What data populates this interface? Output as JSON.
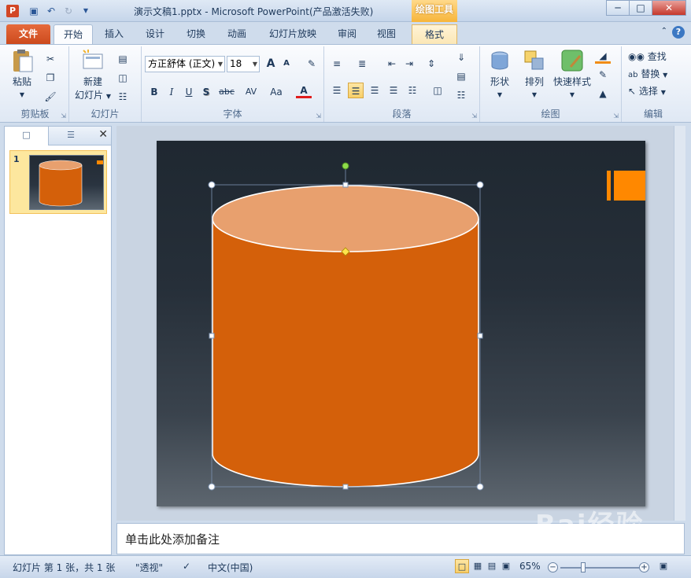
{
  "window": {
    "title": "演示文稿1.pptx - Microsoft PowerPoint(产品激活失败)",
    "app_icon_letter": "P",
    "contextual_tab_title": "绘图工具",
    "minimize": "─",
    "maximize": "□",
    "close": "✕"
  },
  "tabs": {
    "file": "文件",
    "home": "开始",
    "insert": "插入",
    "design": "设计",
    "transitions": "切换",
    "animations": "动画",
    "slideshow": "幻灯片放映",
    "review": "审阅",
    "view": "视图",
    "format": "格式"
  },
  "ribbon": {
    "clipboard": {
      "label": "剪贴板",
      "paste": "粘贴"
    },
    "slides": {
      "label": "幻灯片",
      "new_slide_line1": "新建",
      "new_slide_line2": "幻灯片"
    },
    "font": {
      "label": "字体",
      "font_name": "方正舒体 (正文)",
      "font_size": "18",
      "bold": "B",
      "italic": "I",
      "underline": "U",
      "shadow": "S",
      "strike": "abc",
      "spacing": "AV",
      "case": "Aa",
      "color": "A",
      "grow": "A",
      "shrink": "A"
    },
    "paragraph": {
      "label": "段落"
    },
    "drawing": {
      "label": "绘图",
      "shapes": "形状",
      "arrange": "排列",
      "quick_styles": "快速样式"
    },
    "editing": {
      "label": "编辑",
      "find": "查找",
      "replace": "替换",
      "select": "选择"
    }
  },
  "left_pane": {
    "slide_number": "1"
  },
  "notes": {
    "placeholder": "单击此处添加备注"
  },
  "status": {
    "slide_info": "幻灯片 第 1 张，共 1 张",
    "theme": "\"透视\"",
    "language": "中文(中国)",
    "zoom": "65%"
  },
  "colors": {
    "cylinder_body": "#d4600a",
    "cylinder_top": "#e8a06e",
    "slide_accent": "#ff8800",
    "file_tab": "#d9562a"
  },
  "watermark": "Bai经验"
}
